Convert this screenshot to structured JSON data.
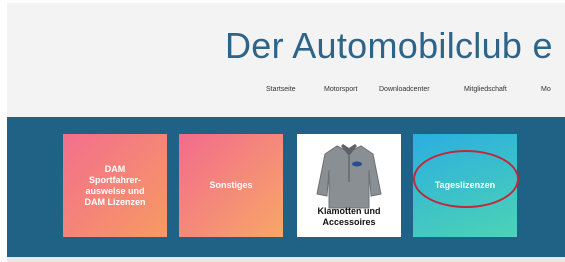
{
  "header": {
    "site_title": "Der Automobilclub e"
  },
  "nav": {
    "items": [
      "Startseite",
      "Motorsport",
      "Downloadcenter",
      "Mitgliedschaft",
      "Mo"
    ]
  },
  "tiles": [
    {
      "label": "DAM\nSportfahrer-\nausweise und\nDAM Lizenzen"
    },
    {
      "label": "Sonstiges"
    },
    {
      "label": "Klamotten und\nAccessoires",
      "image": "jacket"
    },
    {
      "label": "Tageslizenzen"
    }
  ],
  "colors": {
    "title": "#2f6489",
    "band": "#1f6286",
    "highlight": "#c0283c"
  }
}
